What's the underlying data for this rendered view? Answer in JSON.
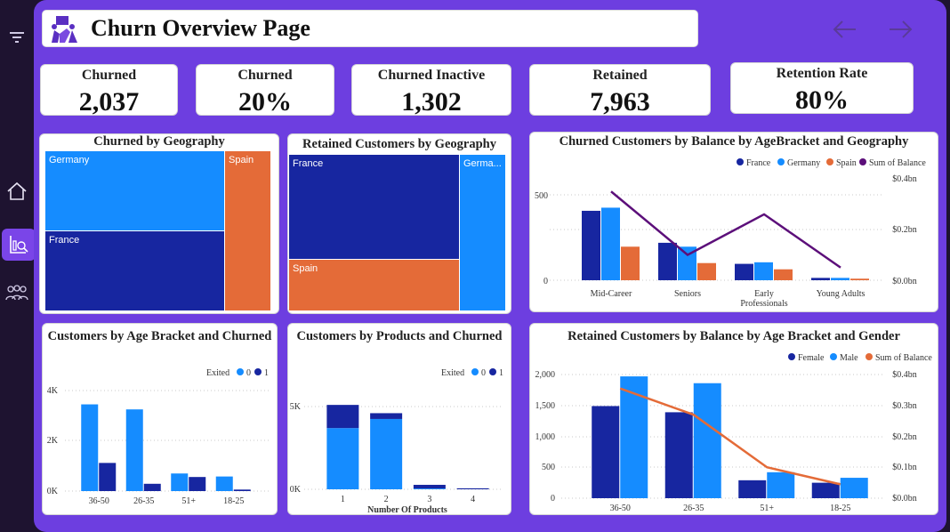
{
  "page": {
    "title": "Churn Overview Page"
  },
  "colors": {
    "canvas": "#6d3ee0",
    "sidebar": "#1e1330",
    "dark_blue": "#1726a0",
    "light_blue": "#158cff",
    "orange": "#e46b38",
    "purple_line": "#5c0f7a"
  },
  "sidebar": {
    "icons": [
      "filter-icon",
      "home-icon",
      "report-analysis-icon",
      "people-icon"
    ]
  },
  "kpis": [
    {
      "label": "Churned",
      "value": "2,037"
    },
    {
      "label": "Churned",
      "value": "20%"
    },
    {
      "label": "Churned Inactive",
      "value": "1,302"
    },
    {
      "label": "Retained",
      "value": "7,963"
    },
    {
      "label": "Retention Rate",
      "value": "80%"
    }
  ],
  "charts": {
    "geo_churn": {
      "title": "Churned by Geography",
      "labels": {
        "germany": "Germany",
        "france": "France",
        "spain": "Spain"
      }
    },
    "geo_retained": {
      "title": "Retained Customers by Geography",
      "labels": {
        "france": "France",
        "spain": "Spain",
        "germany": "Germa..."
      }
    },
    "balance_age_geo": {
      "title": "Churned Customers by Balance by AgeBracket and Geography",
      "legend": [
        "France",
        "Germany",
        "Spain",
        "Sum of Balance"
      ],
      "categories": [
        "Mid-Career",
        "Seniors",
        "Early\nProfessionals",
        "Young Adults"
      ],
      "y_ticks": [
        "500",
        "0"
      ],
      "y2_ticks": [
        "$0.4bn",
        "$0.2bn",
        "$0.0bn"
      ]
    },
    "age_churn": {
      "title": "Customers by Age Bracket and Churned",
      "legend_title": "Exited",
      "legend": [
        "0",
        "1"
      ],
      "categories": [
        "36-50",
        "26-35",
        "51+",
        "18-25"
      ],
      "y_ticks": [
        "4K",
        "2K",
        "0K"
      ]
    },
    "products_churn": {
      "title": "Customers by Products and Churned",
      "legend_title": "Exited",
      "legend": [
        "0",
        "1"
      ],
      "categories": [
        "1",
        "2",
        "3",
        "4"
      ],
      "y_ticks": [
        "5K",
        "0K"
      ],
      "xlabel": "Number Of Products"
    },
    "retained_age_gender": {
      "title": "Retained Customers by Balance by Age Bracket and Gender",
      "legend": [
        "Female",
        "Male",
        "Sum of Balance"
      ],
      "categories": [
        "36-50",
        "26-35",
        "51+",
        "18-25"
      ],
      "y_ticks": [
        "2,000",
        "1,500",
        "1,000",
        "500",
        "0"
      ],
      "y2_ticks": [
        "$0.4bn",
        "$0.3bn",
        "$0.2bn",
        "$0.1bn",
        "$0.0bn"
      ]
    }
  },
  "chart_data": [
    {
      "type": "treemap",
      "title": "Churned by Geography",
      "categories": [
        "Germany",
        "France",
        "Spain"
      ],
      "values": [
        814,
        810,
        413
      ]
    },
    {
      "type": "treemap",
      "title": "Retained Customers by Geography",
      "categories": [
        "France",
        "Spain",
        "Germany"
      ],
      "values": [
        4204,
        2064,
        1695
      ]
    },
    {
      "type": "bar",
      "title": "Churned Customers by Balance by AgeBracket and Geography",
      "categories": [
        "Mid-Career",
        "Seniors",
        "Early Professionals",
        "Young Adults"
      ],
      "series": [
        {
          "name": "France",
          "values": [
            445,
            240,
            105,
            15
          ]
        },
        {
          "name": "Germany",
          "values": [
            465,
            215,
            115,
            15
          ]
        },
        {
          "name": "Spain",
          "values": [
            215,
            110,
            70,
            10
          ]
        },
        {
          "name": "Sum of Balance",
          "axis": "secondary",
          "values": [
            0.35,
            0.1,
            0.26,
            0.05
          ]
        }
      ],
      "ylim": [
        0,
        650
      ],
      "y2lim": [
        0,
        0.4
      ]
    },
    {
      "type": "bar",
      "title": "Customers by Age Bracket and Churned",
      "categories": [
        "36-50",
        "26-35",
        "51+",
        "18-25"
      ],
      "series": [
        {
          "name": "0",
          "values": [
            3450,
            3250,
            700,
            580
          ]
        },
        {
          "name": "1",
          "values": [
            1120,
            290,
            560,
            60
          ]
        }
      ],
      "ylim": [
        0,
        4200
      ]
    },
    {
      "type": "bar",
      "title": "Customers by Products and Churned",
      "categories": [
        "1",
        "2",
        "3",
        "4"
      ],
      "series": [
        {
          "name": "0",
          "values": [
            3700,
            4250,
            50,
            0
          ]
        },
        {
          "name": "1",
          "values": [
            1400,
            350,
            220,
            60
          ]
        }
      ],
      "stacked": true,
      "ylim": [
        0,
        6500
      ],
      "xlabel": "Number Of Products"
    },
    {
      "type": "bar",
      "title": "Retained Customers by Balance by Age Bracket and Gender",
      "categories": [
        "36-50",
        "26-35",
        "51+",
        "18-25"
      ],
      "series": [
        {
          "name": "Female",
          "values": [
            1490,
            1390,
            290,
            250
          ]
        },
        {
          "name": "Male",
          "values": [
            1970,
            1860,
            420,
            330
          ]
        },
        {
          "name": "Sum of Balance",
          "axis": "secondary",
          "values": [
            0.355,
            0.27,
            0.1,
            0.045
          ]
        }
      ],
      "ylim": [
        0,
        2100
      ],
      "y2lim": [
        0,
        0.42
      ]
    }
  ]
}
